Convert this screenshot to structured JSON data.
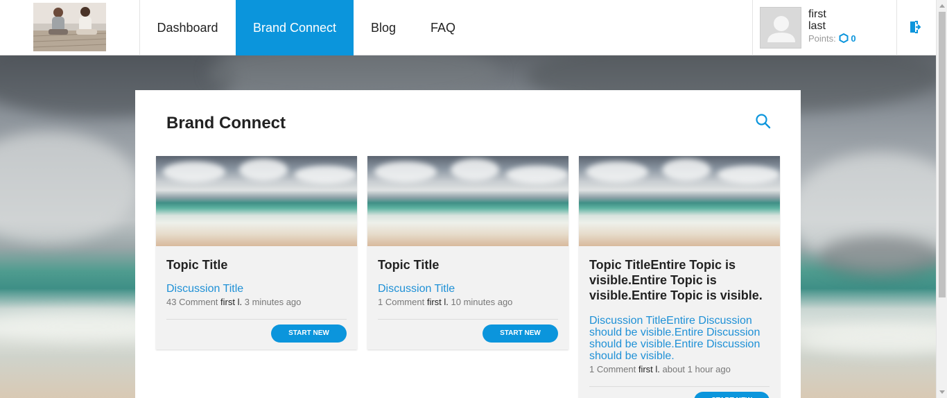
{
  "nav": {
    "items": [
      {
        "label": "Dashboard"
      },
      {
        "label": "Brand Connect"
      },
      {
        "label": "Blog"
      },
      {
        "label": "FAQ"
      }
    ],
    "active": "Brand Connect"
  },
  "user": {
    "first": "first",
    "last": "last",
    "points_label": "Points:",
    "points_value": "0"
  },
  "page": {
    "title": "Brand Connect"
  },
  "cards": [
    {
      "topic": "Topic Title",
      "discussion": "Discussion Title",
      "comments": "43 Comment",
      "author": "first l.",
      "time": "3 minutes ago",
      "button": "START NEW"
    },
    {
      "topic": "Topic Title",
      "discussion": "Discussion Title",
      "comments": "1 Comment",
      "author": "first l.",
      "time": "10 minutes ago",
      "button": "START NEW"
    },
    {
      "topic": "Topic TitleEntire Topic is visible.Entire Topic is visible.Entire Topic is visible.",
      "discussion": "Discussion TitleEntire Discussion should be visible.Entire Discussion should be visible.Entire Discussion should be visible.",
      "comments": "1 Comment",
      "author": "first l.",
      "time": "about 1 hour ago",
      "button": "START NEW"
    }
  ],
  "colors": {
    "accent": "#0b95dc",
    "link": "#1e90d6",
    "card_bg": "#f2f2f2"
  },
  "icons": [
    "logo-photo",
    "user-avatar-icon",
    "points-hexagon-icon",
    "logout-icon",
    "search-icon"
  ]
}
